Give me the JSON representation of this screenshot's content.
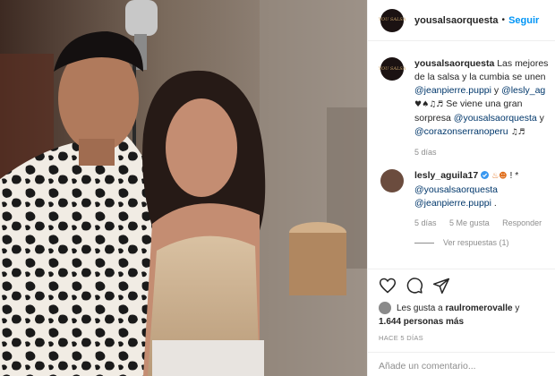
{
  "post": {
    "username": "yousalsaorquesta",
    "separator": "•",
    "follow_label": "Seguir",
    "avatar_text": "YOU SALSA"
  },
  "caption": {
    "username": "yousalsaorquesta",
    "line1": "Las mejores",
    "line2": "de la salsa y la cumbia se unen",
    "mention1": "@jeanpierre.puppi",
    "and": "y",
    "mention2": "@lesly_ag",
    "line4_text": "Se viene una gran",
    "line5_text": "sorpresa",
    "mention3": "@yousalsaorquesta",
    "line5_tail": "y",
    "mention4": "@corazonserranoperu",
    "time": "5 días"
  },
  "comment": {
    "username": "lesly_aguila17",
    "tail": "! *",
    "mention1": "@yousalsaorquesta",
    "mention2": "@jeanpierre.puppi",
    "mention2_tail": ".",
    "time": "5 días",
    "likes": "5 Me gusta",
    "reply_label": "Responder",
    "view_replies": "Ver respuestas (1)"
  },
  "likes": {
    "prefix": "Les gusta a",
    "user": "raulromerovalle",
    "suffix": "y",
    "count": "1.644 personas más"
  },
  "timestamp": "HACE 5 DÍAS",
  "add_comment_placeholder": "Añade un comentario...",
  "colors": {
    "accent": "#0095f6",
    "mention": "#00376b",
    "muted": "#8e8e8e"
  },
  "icons": [
    "heart-icon",
    "comment-icon",
    "share-icon",
    "verified-icon"
  ]
}
